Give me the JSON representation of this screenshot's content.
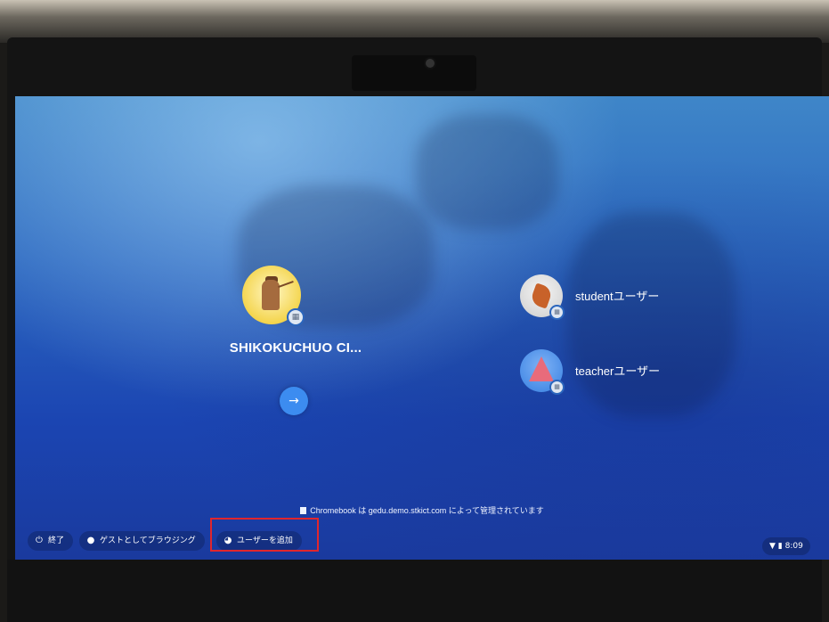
{
  "users": {
    "main": {
      "name": "SHIKOKUCHUO CI...",
      "badge_icon": "enterprise-badge-icon",
      "next_label": "→"
    },
    "others": [
      {
        "name": "studentユーザー",
        "badge_icon": "enterprise-badge-icon"
      },
      {
        "name": "teacherユーザー",
        "badge_icon": "enterprise-badge-icon"
      }
    ]
  },
  "notice": {
    "text": "Chromebook は gedu.demo.stkict.com によって管理されています",
    "icon": "building-icon"
  },
  "shelf": {
    "shutdown": {
      "label": "終了",
      "icon": "power-icon"
    },
    "guest": {
      "label": "ゲストとしてブラウジング",
      "icon": "guest-icon"
    },
    "add_user": {
      "label": "ユーザーを追加",
      "icon": "add-user-icon"
    }
  },
  "status": {
    "time": "8:09",
    "wifi_icon": "wifi-icon",
    "battery_icon": "battery-icon"
  },
  "colors": {
    "highlight": "#e1262d",
    "accent": "#3c8cf0"
  }
}
